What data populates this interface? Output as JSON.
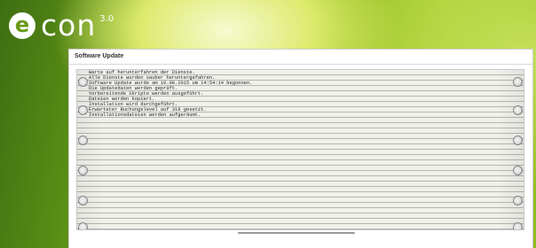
{
  "brand": {
    "logo_text": "con",
    "logo_mark": "e",
    "version": "3.0"
  },
  "panel": {
    "title": "Software Update"
  },
  "log": {
    "lines": [
      "Warte auf herunterfahren der Dienste.",
      "Alle Dienste wurden sauber heruntergefahren.",
      "Software Update wurde am 10.08.2015 um 14:54:14 begonnen.",
      "Die Updatedaten werden geprüft.",
      "Vorbereitende Skripte werden ausgeführt.",
      "Dateien werden kopiert.",
      "Installation wird durchgeführt.",
      "Erwarteter Buchungslevel auf 319 gesetzt.",
      "Installationsdateien werden aufgeräumt."
    ]
  }
}
